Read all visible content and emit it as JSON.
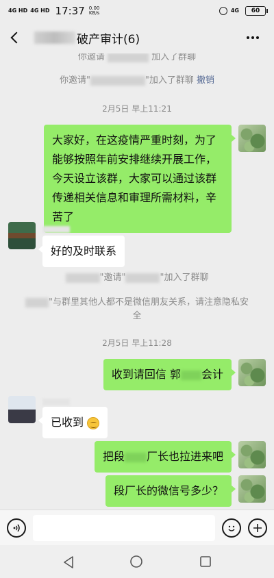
{
  "status": {
    "signal1": "4G HD",
    "signal2": "4G HD",
    "time": "17:37",
    "speed_value": "0.00",
    "speed_unit": "KB/s",
    "network_right": "4G",
    "battery": "60"
  },
  "header": {
    "title": "破产审计(6)"
  },
  "system_messages": {
    "sys1": "你邀请",
    "sys1_suffix": "加入了群聊",
    "sys2_prefix": "你邀请\"",
    "sys2_suffix": "\"加入了群聊",
    "sys2_undo": "撤销",
    "time1": "2月5日 早上11:21",
    "sys3_mid": "\"邀请\"",
    "sys3_suffix": "\"加入了群聊",
    "sys4": "\"与群里其他人都不是微信朋友关系，请注意隐私安全",
    "time2": "2月5日 早上11:28"
  },
  "messages": [
    {
      "side": "right",
      "text": "大家好，在这疫情严重时刻，为了能够按照年前安排继续开展工作，今天设立该群，大家可以通过该群传递相关信息和审理所需材料，辛苦了"
    },
    {
      "side": "left",
      "text": "好的及时联系"
    },
    {
      "side": "right",
      "text_a": "收到请回信 郭",
      "text_b": "会计"
    },
    {
      "side": "left",
      "text": "已收到"
    },
    {
      "side": "right",
      "text_a": "把段",
      "text_b": "厂长也拉进来吧"
    },
    {
      "side": "right",
      "text": "段厂长的微信号多少？"
    }
  ],
  "icons": {
    "back": "back-arrow-icon",
    "more": "more-dots-icon",
    "voice": "voice-icon",
    "emoji": "emoji-icon",
    "add": "plus-icon",
    "nav_back": "nav-back-icon",
    "nav_home": "nav-home-icon",
    "nav_recent": "nav-recent-icon"
  },
  "colors": {
    "sent_bubble": "#95ec69",
    "received_bubble": "#ffffff",
    "background": "#ededed",
    "undo_link": "#576b95"
  }
}
